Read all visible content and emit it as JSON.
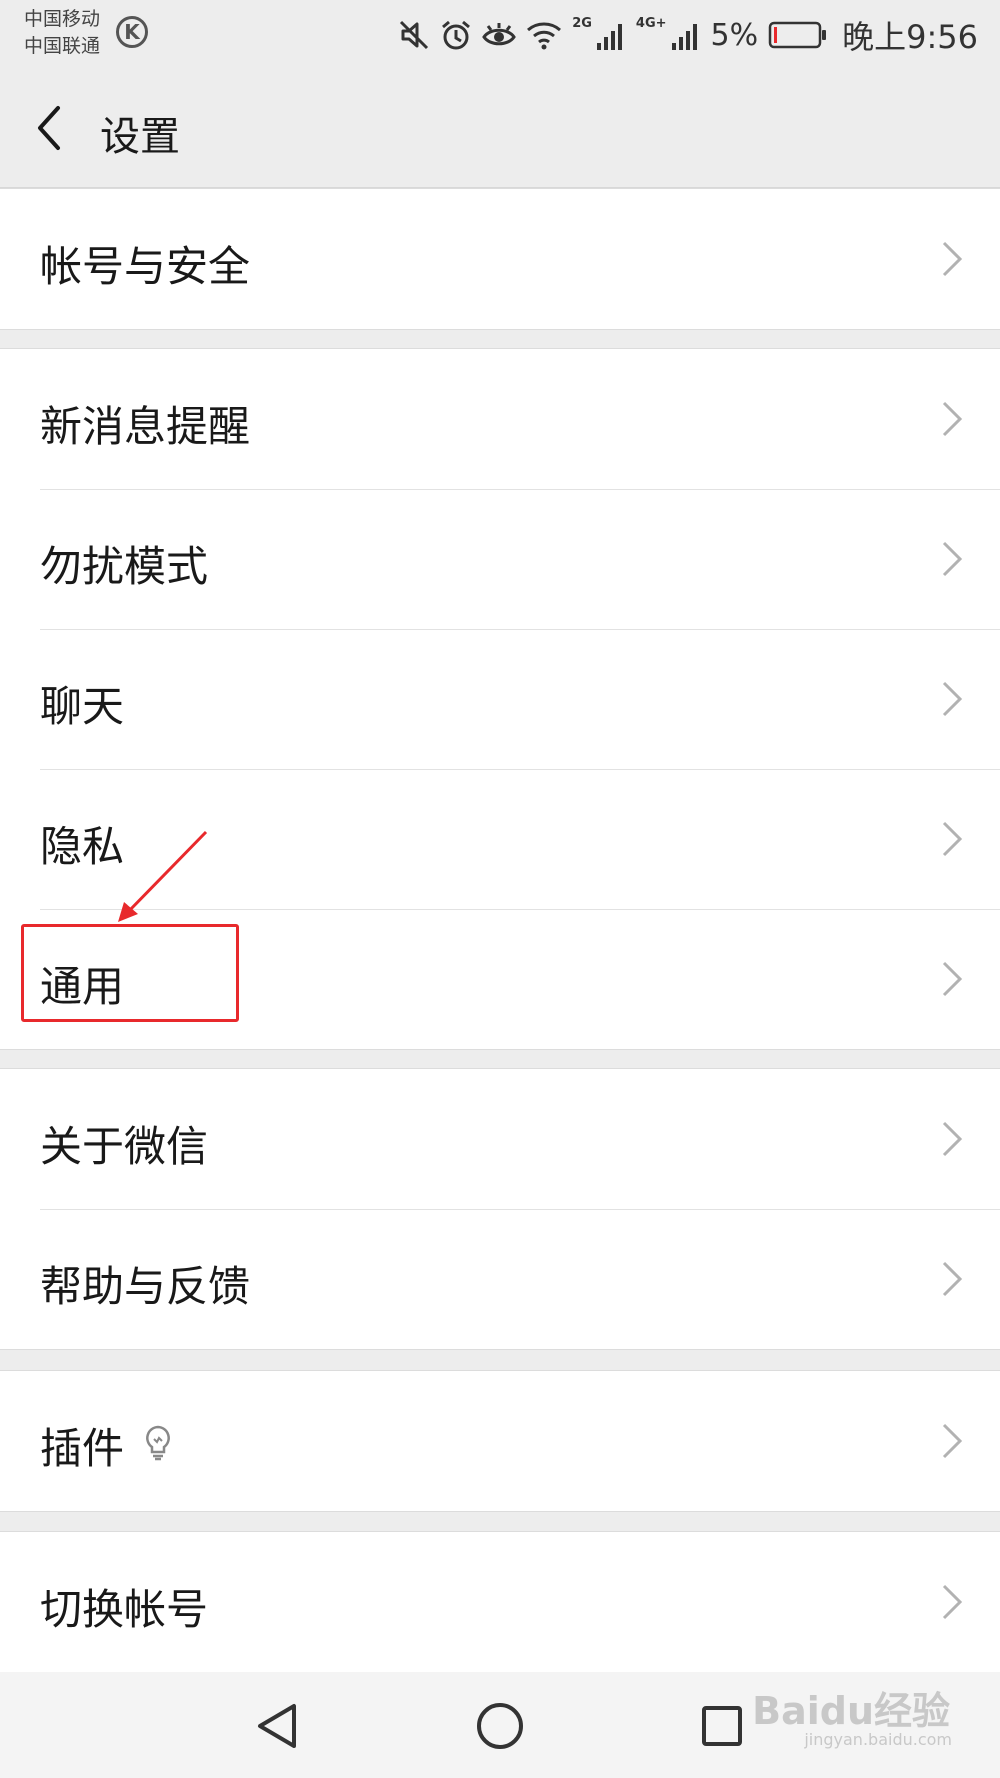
{
  "status_bar": {
    "carrier_1": "中国移动",
    "carrier_2": "中国联通",
    "carrier_badge": "K",
    "net_1": "2G",
    "net_2": "4G+",
    "battery_percent": "5%",
    "time": "晚上9:56",
    "icons": [
      "mute-icon",
      "alarm-icon",
      "eye-comfort-icon",
      "wifi-icon",
      "signal-icon",
      "battery-icon"
    ]
  },
  "header": {
    "title": "设置",
    "back_icon": "chevron-left-icon"
  },
  "groups": [
    {
      "items": [
        {
          "label": "帐号与安全"
        }
      ]
    },
    {
      "items": [
        {
          "label": "新消息提醒"
        },
        {
          "label": "勿扰模式"
        },
        {
          "label": "聊天"
        },
        {
          "label": "隐私"
        },
        {
          "label": "通用"
        }
      ]
    },
    {
      "items": [
        {
          "label": "关于微信"
        },
        {
          "label": "帮助与反馈"
        }
      ]
    },
    {
      "items": [
        {
          "label": "插件",
          "badge_icon": "lightbulb-icon"
        }
      ]
    },
    {
      "items": [
        {
          "label": "切换帐号"
        }
      ]
    }
  ],
  "annotation": {
    "highlighted_item": "通用",
    "color": "#e8292c"
  },
  "nav_bar": {
    "buttons": [
      "back-triangle-icon",
      "home-circle-icon",
      "recents-square-icon"
    ]
  },
  "watermark": {
    "text": "Baidu经验",
    "sub": "jingyan.baidu.com"
  },
  "colors": {
    "background": "#ededed",
    "card": "#ffffff",
    "text": "#191919",
    "chevron": "#b2b2b2",
    "battery_low": "#e8292c"
  }
}
